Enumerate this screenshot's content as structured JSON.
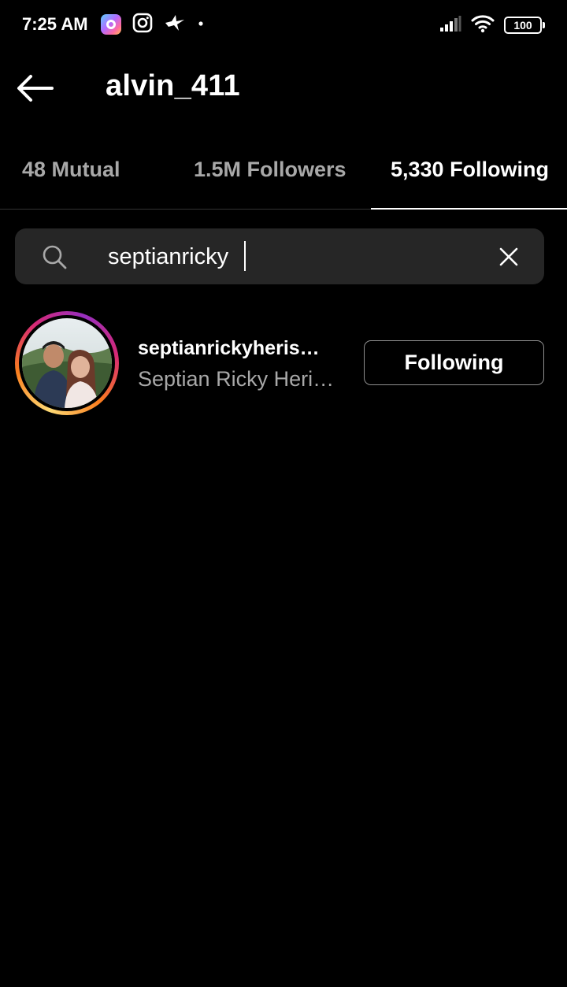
{
  "status_bar": {
    "time": "7:25 AM",
    "battery": "100",
    "icons": [
      "colorful-app-icon",
      "instagram-icon",
      "bird-icon",
      "dot-icon",
      "signal-icon",
      "wifi-icon",
      "battery-icon"
    ]
  },
  "header": {
    "title": "alvin_411",
    "back_icon": "arrow-left-icon"
  },
  "tabs": [
    {
      "label": "48 Mutual",
      "active": false
    },
    {
      "label": "1.5M Followers",
      "active": false
    },
    {
      "label": "5,330 Following",
      "active": true
    }
  ],
  "search": {
    "value": "septianricky",
    "icon": "search-icon",
    "clear_icon": "close-icon"
  },
  "results": [
    {
      "username": "septianrickyheris…",
      "full_name": "Septian Ricky Heri…",
      "button_label": "Following"
    }
  ],
  "colors": {
    "background": "#000000",
    "search_bg": "#262626",
    "secondary_text": "#a8a8a8",
    "button_border": "#8e8e8e"
  }
}
